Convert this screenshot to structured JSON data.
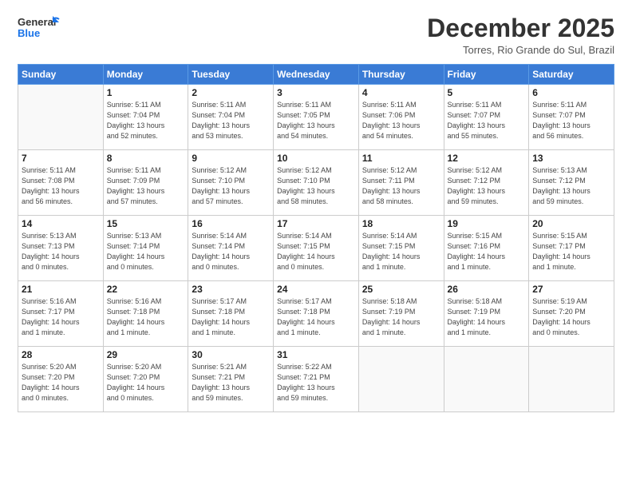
{
  "logo": {
    "line1": "General",
    "line2": "Blue"
  },
  "title": "December 2025",
  "location": "Torres, Rio Grande do Sul, Brazil",
  "days_header": [
    "Sunday",
    "Monday",
    "Tuesday",
    "Wednesday",
    "Thursday",
    "Friday",
    "Saturday"
  ],
  "weeks": [
    [
      {
        "num": "",
        "info": ""
      },
      {
        "num": "1",
        "info": "Sunrise: 5:11 AM\nSunset: 7:04 PM\nDaylight: 13 hours\nand 52 minutes."
      },
      {
        "num": "2",
        "info": "Sunrise: 5:11 AM\nSunset: 7:04 PM\nDaylight: 13 hours\nand 53 minutes."
      },
      {
        "num": "3",
        "info": "Sunrise: 5:11 AM\nSunset: 7:05 PM\nDaylight: 13 hours\nand 54 minutes."
      },
      {
        "num": "4",
        "info": "Sunrise: 5:11 AM\nSunset: 7:06 PM\nDaylight: 13 hours\nand 54 minutes."
      },
      {
        "num": "5",
        "info": "Sunrise: 5:11 AM\nSunset: 7:07 PM\nDaylight: 13 hours\nand 55 minutes."
      },
      {
        "num": "6",
        "info": "Sunrise: 5:11 AM\nSunset: 7:07 PM\nDaylight: 13 hours\nand 56 minutes."
      }
    ],
    [
      {
        "num": "7",
        "info": "Sunrise: 5:11 AM\nSunset: 7:08 PM\nDaylight: 13 hours\nand 56 minutes."
      },
      {
        "num": "8",
        "info": "Sunrise: 5:11 AM\nSunset: 7:09 PM\nDaylight: 13 hours\nand 57 minutes."
      },
      {
        "num": "9",
        "info": "Sunrise: 5:12 AM\nSunset: 7:10 PM\nDaylight: 13 hours\nand 57 minutes."
      },
      {
        "num": "10",
        "info": "Sunrise: 5:12 AM\nSunset: 7:10 PM\nDaylight: 13 hours\nand 58 minutes."
      },
      {
        "num": "11",
        "info": "Sunrise: 5:12 AM\nSunset: 7:11 PM\nDaylight: 13 hours\nand 58 minutes."
      },
      {
        "num": "12",
        "info": "Sunrise: 5:12 AM\nSunset: 7:12 PM\nDaylight: 13 hours\nand 59 minutes."
      },
      {
        "num": "13",
        "info": "Sunrise: 5:13 AM\nSunset: 7:12 PM\nDaylight: 13 hours\nand 59 minutes."
      }
    ],
    [
      {
        "num": "14",
        "info": "Sunrise: 5:13 AM\nSunset: 7:13 PM\nDaylight: 14 hours\nand 0 minutes."
      },
      {
        "num": "15",
        "info": "Sunrise: 5:13 AM\nSunset: 7:14 PM\nDaylight: 14 hours\nand 0 minutes."
      },
      {
        "num": "16",
        "info": "Sunrise: 5:14 AM\nSunset: 7:14 PM\nDaylight: 14 hours\nand 0 minutes."
      },
      {
        "num": "17",
        "info": "Sunrise: 5:14 AM\nSunset: 7:15 PM\nDaylight: 14 hours\nand 0 minutes."
      },
      {
        "num": "18",
        "info": "Sunrise: 5:14 AM\nSunset: 7:15 PM\nDaylight: 14 hours\nand 1 minute."
      },
      {
        "num": "19",
        "info": "Sunrise: 5:15 AM\nSunset: 7:16 PM\nDaylight: 14 hours\nand 1 minute."
      },
      {
        "num": "20",
        "info": "Sunrise: 5:15 AM\nSunset: 7:17 PM\nDaylight: 14 hours\nand 1 minute."
      }
    ],
    [
      {
        "num": "21",
        "info": "Sunrise: 5:16 AM\nSunset: 7:17 PM\nDaylight: 14 hours\nand 1 minute."
      },
      {
        "num": "22",
        "info": "Sunrise: 5:16 AM\nSunset: 7:18 PM\nDaylight: 14 hours\nand 1 minute."
      },
      {
        "num": "23",
        "info": "Sunrise: 5:17 AM\nSunset: 7:18 PM\nDaylight: 14 hours\nand 1 minute."
      },
      {
        "num": "24",
        "info": "Sunrise: 5:17 AM\nSunset: 7:18 PM\nDaylight: 14 hours\nand 1 minute."
      },
      {
        "num": "25",
        "info": "Sunrise: 5:18 AM\nSunset: 7:19 PM\nDaylight: 14 hours\nand 1 minute."
      },
      {
        "num": "26",
        "info": "Sunrise: 5:18 AM\nSunset: 7:19 PM\nDaylight: 14 hours\nand 1 minute."
      },
      {
        "num": "27",
        "info": "Sunrise: 5:19 AM\nSunset: 7:20 PM\nDaylight: 14 hours\nand 0 minutes."
      }
    ],
    [
      {
        "num": "28",
        "info": "Sunrise: 5:20 AM\nSunset: 7:20 PM\nDaylight: 14 hours\nand 0 minutes."
      },
      {
        "num": "29",
        "info": "Sunrise: 5:20 AM\nSunset: 7:20 PM\nDaylight: 14 hours\nand 0 minutes."
      },
      {
        "num": "30",
        "info": "Sunrise: 5:21 AM\nSunset: 7:21 PM\nDaylight: 13 hours\nand 59 minutes."
      },
      {
        "num": "31",
        "info": "Sunrise: 5:22 AM\nSunset: 7:21 PM\nDaylight: 13 hours\nand 59 minutes."
      },
      {
        "num": "",
        "info": ""
      },
      {
        "num": "",
        "info": ""
      },
      {
        "num": "",
        "info": ""
      }
    ]
  ]
}
